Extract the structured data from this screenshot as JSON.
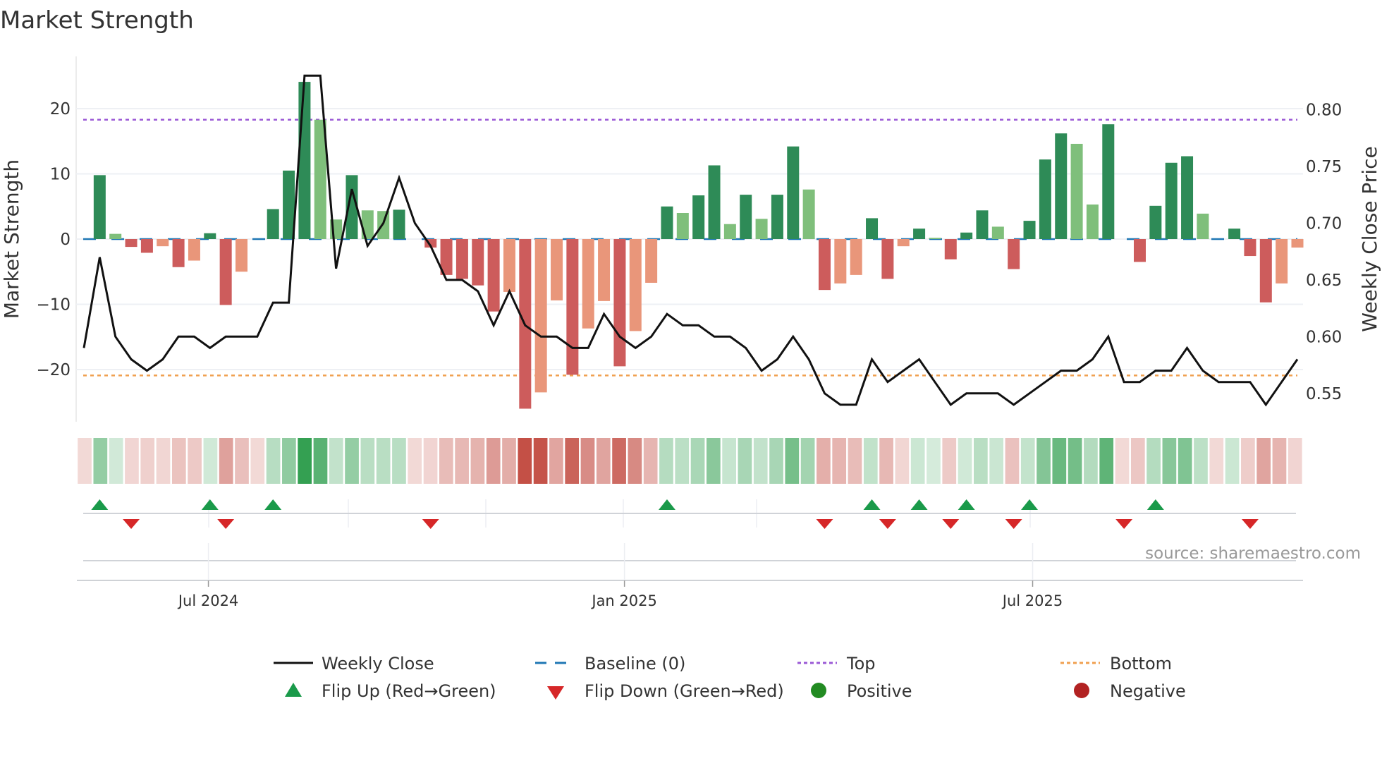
{
  "title": "Market Strength",
  "source": "source: sharemaestro.com",
  "colors": {
    "pos_strong": "#2e8b57",
    "pos_weak": "#7fbf7b",
    "neg_strong": "#cd5c5c",
    "neg_weak": "#e9967a",
    "baseline": "#1f77b4",
    "top": "#9b59d6",
    "bottom": "#f0a050",
    "line": "#111111",
    "flip_up": "#1a9a4a",
    "flip_down": "#d62728",
    "positive": "#228b22",
    "negative": "#b22222"
  },
  "legend": [
    {
      "label": "Weekly Close",
      "symbol": "line"
    },
    {
      "label": "Baseline (0)",
      "symbol": "dash"
    },
    {
      "label": "Top",
      "symbol": "dot-purple"
    },
    {
      "label": "Bottom",
      "symbol": "dot-orange"
    },
    {
      "label": "Flip Up (Red→Green)",
      "symbol": "triangle-up"
    },
    {
      "label": "Flip Down (Green→Red)",
      "symbol": "triangle-down"
    },
    {
      "label": "Positive",
      "symbol": "circle-green"
    },
    {
      "label": "Negative",
      "symbol": "circle-red"
    }
  ],
  "chart_data": {
    "type": "bar",
    "title": "Market Strength",
    "ylabel": "Market Strength",
    "y2label": "Weekly Close Price",
    "ylim": [
      -28,
      28
    ],
    "y2lim": [
      0.525,
      0.847
    ],
    "yticks": [
      20,
      10,
      0,
      -10,
      -20
    ],
    "ytick_labels": [
      "20",
      "10",
      "0",
      "−10",
      "−20"
    ],
    "y2ticks": [
      0.8,
      0.75,
      0.7,
      0.65,
      0.6,
      0.55
    ],
    "y2tick_labels": [
      "0.80",
      "0.75",
      "0.70",
      "0.65",
      "0.60",
      "0.55"
    ],
    "xticks": [
      {
        "index": 7.9,
        "label": "Jul 2024"
      },
      {
        "index": 34.3,
        "label": "Jan 2025"
      },
      {
        "index": 60.2,
        "label": "Jul 2025"
      }
    ],
    "top": 18.3,
    "bottom": -20.9,
    "strength": [
      0,
      9.8,
      0.8,
      -1.2,
      -2.1,
      -1.1,
      -4.3,
      -3.3,
      0.9,
      -10.1,
      -5.0,
      0,
      4.6,
      10.5,
      24.1,
      18.3,
      3.0,
      9.8,
      4.4,
      4.3,
      4.5,
      0,
      -1.3,
      -5.5,
      -6.1,
      -7.1,
      -11.1,
      -8.1,
      -26.0,
      -23.5,
      -9.4,
      -20.8,
      -13.7,
      -9.5,
      -19.5,
      -14.1,
      -6.7,
      5.0,
      4.0,
      6.7,
      11.3,
      2.3,
      6.8,
      3.1,
      6.8,
      14.2,
      7.6,
      -7.8,
      -6.8,
      -5.5,
      3.2,
      -6.1,
      -1.1,
      1.6,
      0.2,
      -3.1,
      1.0,
      4.4,
      1.9,
      -4.6,
      2.8,
      12.2,
      16.2,
      14.6,
      5.3,
      17.6,
      0,
      -3.5,
      5.1,
      11.7,
      12.7,
      3.9,
      0,
      1.6,
      -2.6,
      -9.7,
      -6.8,
      -1.3
    ],
    "shade": [
      "s",
      "s",
      "w",
      "s",
      "s",
      "w",
      "s",
      "w",
      "s",
      "s",
      "w",
      "s",
      "s",
      "s",
      "s",
      "w",
      "w",
      "s",
      "w",
      "w",
      "s",
      "s",
      "s",
      "s",
      "s",
      "s",
      "s",
      "w",
      "s",
      "w",
      "w",
      "s",
      "w",
      "w",
      "s",
      "w",
      "w",
      "s",
      "w",
      "s",
      "s",
      "w",
      "s",
      "w",
      "s",
      "s",
      "w",
      "s",
      "w",
      "w",
      "s",
      "s",
      "w",
      "s",
      "w",
      "s",
      "s",
      "s",
      "w",
      "s",
      "s",
      "s",
      "s",
      "w",
      "w",
      "s",
      "s",
      "s",
      "s",
      "s",
      "s",
      "w",
      "s",
      "s",
      "s",
      "s",
      "w",
      "w"
    ],
    "weekly_close": [
      0.59,
      0.67,
      0.6,
      0.58,
      0.57,
      0.58,
      0.6,
      0.6,
      0.59,
      0.6,
      0.6,
      0.6,
      0.63,
      0.63,
      0.83,
      0.83,
      0.66,
      0.73,
      0.68,
      0.7,
      0.74,
      0.7,
      0.68,
      0.65,
      0.65,
      0.64,
      0.61,
      0.64,
      0.61,
      0.6,
      0.6,
      0.59,
      0.59,
      0.62,
      0.6,
      0.59,
      0.6,
      0.62,
      0.61,
      0.61,
      0.6,
      0.6,
      0.59,
      0.57,
      0.58,
      0.6,
      0.58,
      0.55,
      0.54,
      0.54,
      0.58,
      0.56,
      0.57,
      0.58,
      0.56,
      0.54,
      0.55,
      0.55,
      0.55,
      0.54,
      0.55,
      0.56,
      0.57,
      0.57,
      0.58,
      0.6,
      0.56,
      0.56,
      0.57,
      0.57,
      0.59,
      0.57,
      0.56,
      0.56,
      0.56,
      0.54,
      0.56,
      0.58
    ],
    "flip_up": [
      1,
      8,
      12,
      37,
      50,
      53,
      56,
      60,
      68
    ],
    "flip_down": [
      3,
      9,
      22,
      47,
      51,
      55,
      59,
      66,
      74
    ]
  }
}
